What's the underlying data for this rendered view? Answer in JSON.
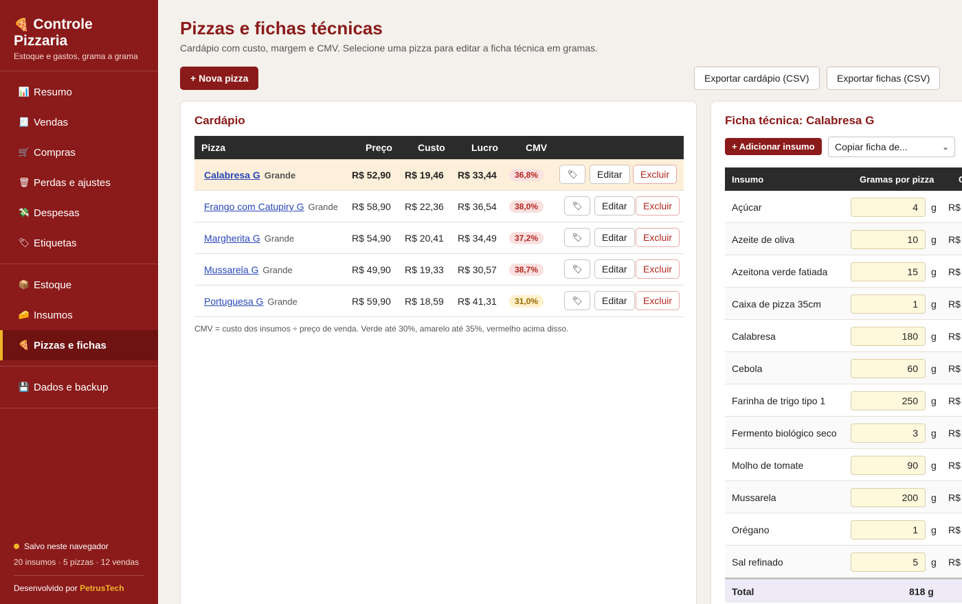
{
  "sidebar": {
    "brand": "Controle Pizzaria",
    "subtitle": "Estoque e gastos, grama a grama",
    "groups": [
      [
        {
          "label": "Resumo",
          "icon": "chart-icon",
          "glyph": "📊"
        },
        {
          "label": "Vendas",
          "icon": "receipt-icon",
          "glyph": "🧾"
        },
        {
          "label": "Compras",
          "icon": "cart-icon",
          "glyph": "🛒"
        },
        {
          "label": "Perdas e ajustes",
          "icon": "trash-icon",
          "glyph": "🗑"
        },
        {
          "label": "Despesas",
          "icon": "money-icon",
          "glyph": "💸"
        },
        {
          "label": "Etiquetas",
          "icon": "tag-icon",
          "glyph": "🏷"
        }
      ],
      [
        {
          "label": "Estoque",
          "icon": "box-icon",
          "glyph": "📦"
        },
        {
          "label": "Insumos",
          "icon": "cheese-icon",
          "glyph": "🧀"
        },
        {
          "label": "Pizzas e fichas",
          "icon": "pizza-icon",
          "glyph": "🍕",
          "active": true
        }
      ],
      [
        {
          "label": "Dados e backup",
          "icon": "floppy-icon",
          "glyph": "💾"
        }
      ]
    ],
    "status": "Salvo neste navegador",
    "counts": "20 insumos · 5 pizzas · 12 vendas",
    "dev_prefix": "Desenvolvido por",
    "dev_name": "PetrusTech"
  },
  "header": {
    "title": "Pizzas e fichas técnicas",
    "subtitle": "Cardápio com custo, margem e CMV. Selecione uma pizza para editar a ficha técnica em gramas.",
    "new_pizza": "+ Nova pizza",
    "export_menu": "Exportar cardápio (CSV)",
    "export_sheets": "Exportar fichas (CSV)"
  },
  "menu": {
    "title": "Cardápio",
    "columns": [
      "Pizza",
      "Preço",
      "Custo",
      "Lucro",
      "CMV"
    ],
    "rows": [
      {
        "name": "Calabresa G",
        "size": "Grande",
        "price": "R$ 52,90",
        "cost": "R$ 19,46",
        "profit": "R$ 33,44",
        "cmv": "36,8%",
        "level": "red",
        "selected": true
      },
      {
        "name": "Frango com Catupiry G",
        "size": "Grande",
        "price": "R$ 58,90",
        "cost": "R$ 22,36",
        "profit": "R$ 36,54",
        "cmv": "38,0%",
        "level": "red"
      },
      {
        "name": "Margherita G",
        "size": "Grande",
        "price": "R$ 54,90",
        "cost": "R$ 20,41",
        "profit": "R$ 34,49",
        "cmv": "37,2%",
        "level": "red"
      },
      {
        "name": "Mussarela G",
        "size": "Grande",
        "price": "R$ 49,90",
        "cost": "R$ 19,33",
        "profit": "R$ 30,57",
        "cmv": "38,7%",
        "level": "red"
      },
      {
        "name": "Portuguesa G",
        "size": "Grande",
        "price": "R$ 59,90",
        "cost": "R$ 18,59",
        "profit": "R$ 41,31",
        "cmv": "31,0%",
        "level": "yellow"
      }
    ],
    "edit_label": "Editar",
    "delete_label": "Excluir",
    "tag_glyph": "🏷",
    "note": "CMV = custo dos insumos ÷ preço de venda. Verde até 30%, amarelo até 35%, vermelho acima disso."
  },
  "recipe": {
    "title": "Ficha técnica: Calabresa G",
    "add_label": "+ Adicionar insumo",
    "copy_label": "Copiar ficha de...",
    "col_insumo": "Insumo",
    "col_grams": "Gramas por pizza",
    "col_cost": "C",
    "unit": "g",
    "currency": "R$",
    "rows": [
      {
        "name": "Açúcar",
        "grams": "4"
      },
      {
        "name": "Azeite de oliva",
        "grams": "10"
      },
      {
        "name": "Azeitona verde fatiada",
        "grams": "15"
      },
      {
        "name": "Caixa de pizza 35cm",
        "grams": "1"
      },
      {
        "name": "Calabresa",
        "grams": "180"
      },
      {
        "name": "Cebola",
        "grams": "60"
      },
      {
        "name": "Farinha de trigo tipo 1",
        "grams": "250"
      },
      {
        "name": "Fermento biológico seco",
        "grams": "3"
      },
      {
        "name": "Molho de tomate",
        "grams": "90"
      },
      {
        "name": "Mussarela",
        "grams": "200"
      },
      {
        "name": "Orégano",
        "grams": "1"
      },
      {
        "name": "Sal refinado",
        "grams": "5"
      }
    ],
    "total_label": "Total",
    "total_value": "818 g"
  }
}
